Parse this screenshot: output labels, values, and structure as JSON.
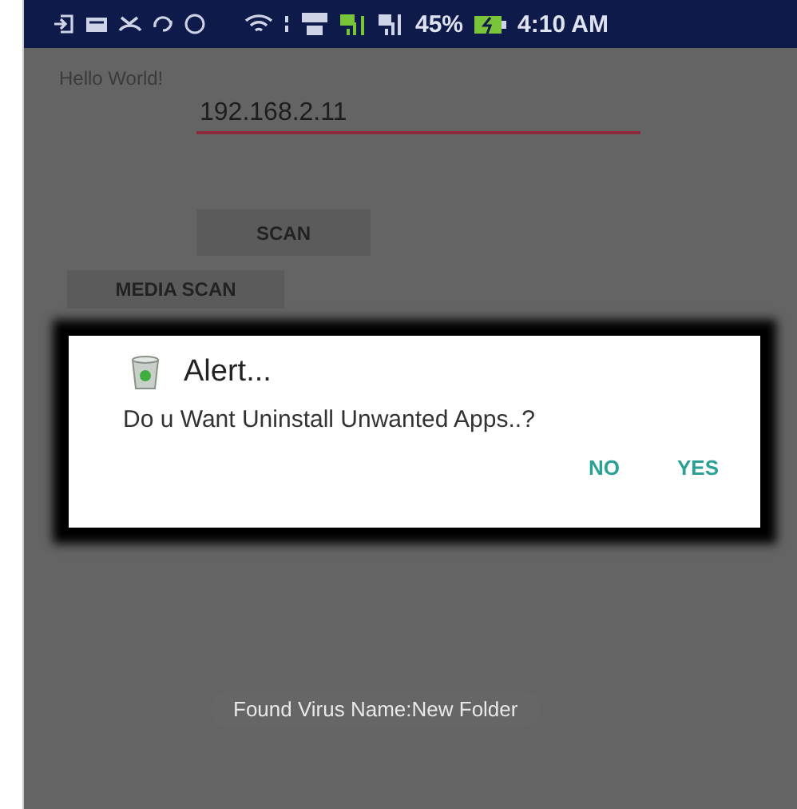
{
  "status_bar": {
    "battery": "45%",
    "time": "4:10 AM"
  },
  "app": {
    "label": "Hello World!",
    "ip_field": {
      "value": "192.168.2.11"
    },
    "buttons": [
      "SCAN",
      "MEDIA SCAN"
    ]
  },
  "dialog": {
    "title": "Alert...",
    "message": "Do u Want Uninstall Unwanted Apps..?",
    "buttons": [
      "NO",
      "YES"
    ]
  },
  "toast": "Found Virus Name:New Folder"
}
